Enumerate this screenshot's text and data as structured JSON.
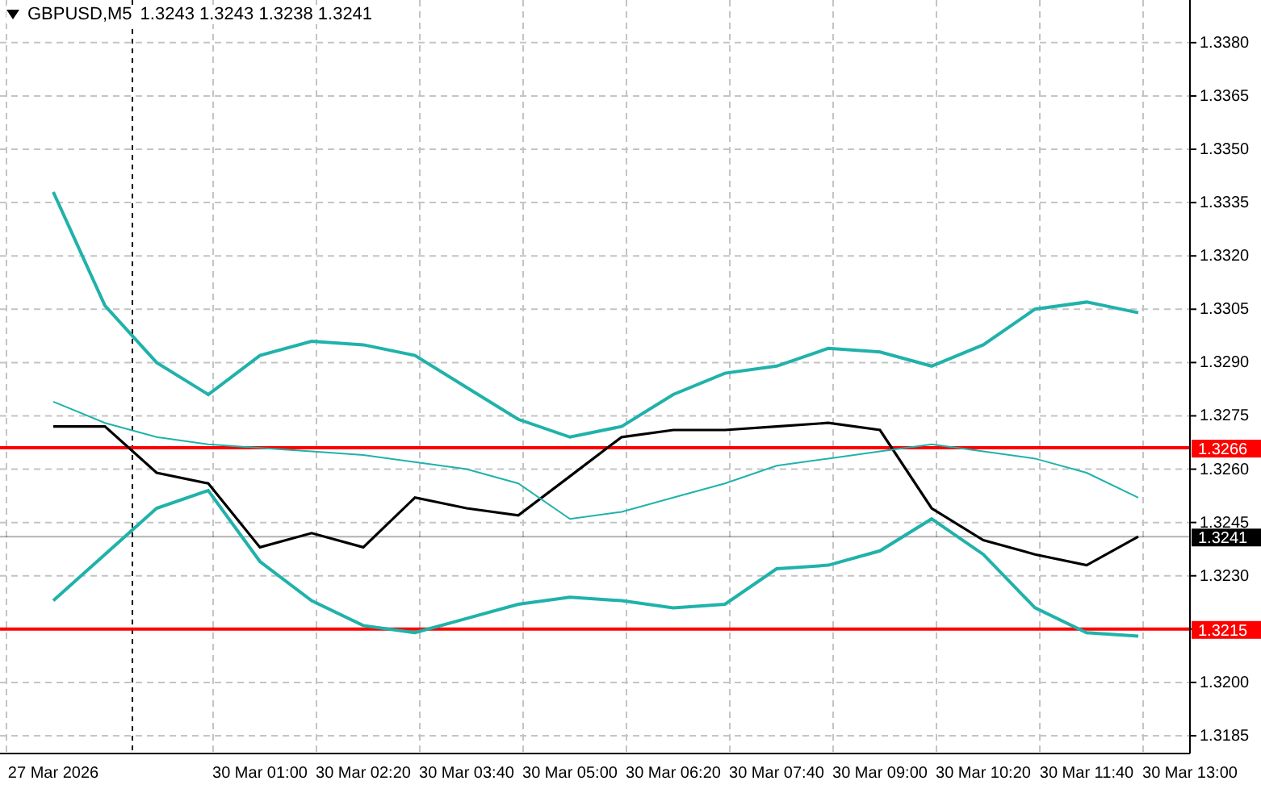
{
  "header": {
    "symbol": "GBPUSD,M5",
    "quote": "1.3243 1.3243 1.3238 1.3241"
  },
  "chart": {
    "chart_data": {
      "type": "line",
      "grid": true,
      "categories": [
        "27 Mar 2026",
        null,
        null,
        null,
        "30 Mar 01:00",
        null,
        "30 Mar 02:20",
        null,
        "30 Mar 03:40",
        null,
        "30 Mar 05:00",
        null,
        "30 Mar 06:20",
        null,
        "30 Mar 07:40",
        null,
        "30 Mar 09:00",
        null,
        "30 Mar 10:20",
        null,
        "30 Mar 11:40",
        null,
        "30 Mar 13:00"
      ],
      "series": [
        {
          "color": "#000000",
          "values": [
            1.3272,
            1.3272,
            1.3259,
            1.3256,
            1.3238,
            1.3242,
            1.3238,
            1.3252,
            1.3249,
            1.3247,
            1.3258,
            1.3269,
            1.3271,
            1.3271,
            1.3272,
            1.3273,
            1.3271,
            1.3249,
            1.324,
            1.3236,
            1.3233,
            1.3241,
            null
          ]
        },
        {
          "color": "#20b2aa",
          "values": [
            1.3338,
            1.3306,
            1.329,
            1.3281,
            1.3292,
            1.3296,
            1.3295,
            1.3292,
            1.3283,
            1.3274,
            1.3269,
            1.3272,
            1.3281,
            1.3287,
            1.3289,
            1.3294,
            1.3293,
            1.3289,
            1.3295,
            1.3305,
            1.3307,
            1.3304,
            null
          ]
        },
        {
          "color": "#20b2aa",
          "values": [
            1.3279,
            1.3273,
            1.3269,
            1.3267,
            1.3266,
            1.3265,
            1.3264,
            1.3262,
            1.326,
            1.3256,
            1.3246,
            1.3248,
            1.3252,
            1.3256,
            1.3261,
            1.3263,
            1.3265,
            1.3267,
            1.3265,
            1.3263,
            1.3259,
            1.3252,
            null
          ]
        },
        {
          "color": "#20b2aa",
          "values": [
            1.3223,
            1.3236,
            1.3249,
            1.3254,
            1.3234,
            1.3223,
            1.3216,
            1.3214,
            1.3218,
            1.3222,
            1.3224,
            1.3223,
            1.3221,
            1.3222,
            1.3232,
            1.3233,
            1.3237,
            1.3246,
            1.3236,
            1.3221,
            1.3214,
            1.3213,
            null
          ]
        }
      ],
      "ylim": [
        1.318,
        1.3392
      ],
      "yticks": [
        {
          "value": 1.3185,
          "label": "1.3185"
        },
        {
          "value": 1.32,
          "label": "1.3200"
        },
        {
          "value": 1.3215,
          "label": "1.3215"
        },
        {
          "value": 1.323,
          "label": "1.3230"
        },
        {
          "value": 1.3245,
          "label": "1.3245"
        },
        {
          "value": 1.326,
          "label": "1.3260"
        },
        {
          "value": 1.3275,
          "label": "1.3275"
        },
        {
          "value": 1.329,
          "label": "1.3290"
        },
        {
          "value": 1.3305,
          "label": "1.3305"
        },
        {
          "value": 1.332,
          "label": "1.3320"
        },
        {
          "value": 1.3335,
          "label": "1.3335"
        },
        {
          "value": 1.335,
          "label": "1.3350"
        },
        {
          "value": 1.3365,
          "label": "1.3365"
        },
        {
          "value": 1.338,
          "label": "1.3380"
        }
      ],
      "ref_lines": [
        {
          "axis": "y",
          "value": 1.3266,
          "label": "1.3266",
          "color": "#ff0000"
        },
        {
          "axis": "y",
          "value": 1.3215,
          "label": "1.3215",
          "color": "#ff0000"
        },
        {
          "axis": "y",
          "value": 1.3241,
          "label": "1.3241",
          "color": "#000000"
        }
      ]
    }
  }
}
